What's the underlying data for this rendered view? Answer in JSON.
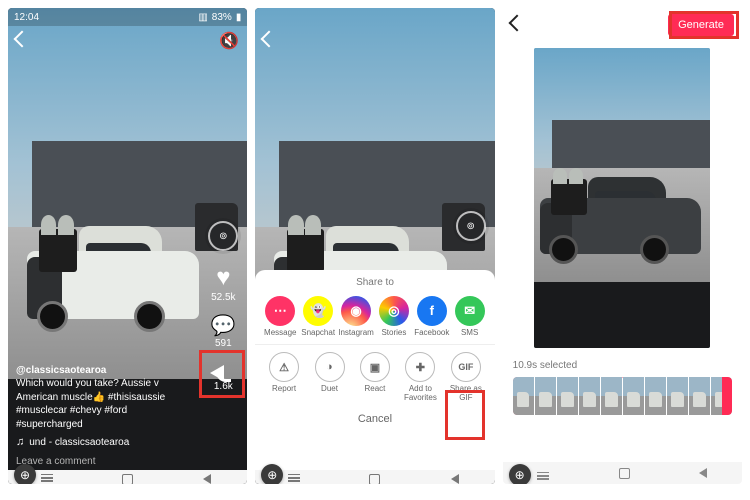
{
  "statusbar": {
    "time": "12:04",
    "battery": "83%",
    "battery_icon": "▮",
    "signal": "▥",
    "wifi": "⋮"
  },
  "feed": {
    "mute_glyph": "🔇",
    "ring_inner": "⊚",
    "like_count": "52.5k",
    "comment_count": "591",
    "share_count": "1.6k",
    "username": "@classicsaotearoa",
    "caption_line1": "Which would you take? Aussie v",
    "caption_line2": "American muscle👍 #thisisaussie",
    "caption_line3": "#musclecar #chevy #ford #supercharged",
    "sound_glyph": "♫",
    "sound_text": "und - classicsaotearoa",
    "comment_placeholder": "Leave a comment"
  },
  "share": {
    "title": "Share to",
    "row1": [
      {
        "label": "Message",
        "color": "#ff3366",
        "glyph": "⋯"
      },
      {
        "label": "Snapchat",
        "color": "#fffc00",
        "glyph": "👻"
      },
      {
        "label": "Instagram",
        "color": "ig",
        "glyph": "◉"
      },
      {
        "label": "Stories",
        "color": "stories",
        "glyph": "◎"
      },
      {
        "label": "Facebook",
        "color": "#1877f2",
        "glyph": "f"
      },
      {
        "label": "SMS",
        "color": "#34c759",
        "glyph": "✉"
      }
    ],
    "row2": [
      {
        "label": "Report",
        "glyph": "⚠"
      },
      {
        "label": "Duet",
        "glyph": "◑"
      },
      {
        "label": "React",
        "glyph": "▣"
      },
      {
        "label": "Add to Favorites",
        "glyph": "✚"
      },
      {
        "label": "Share as GIF",
        "glyph": "GIF"
      }
    ],
    "cancel": "Cancel"
  },
  "editor": {
    "generate": "Generate",
    "selected": "10.9s selected"
  },
  "zoom_glyph": "⊕"
}
